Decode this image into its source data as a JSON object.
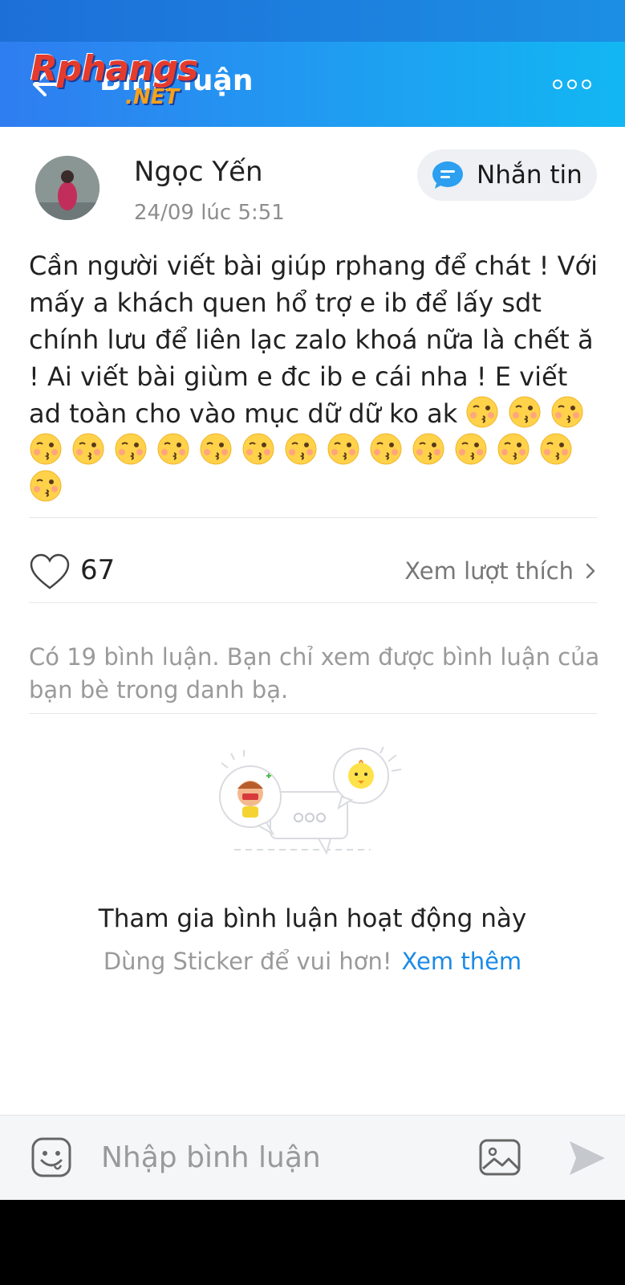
{
  "header": {
    "title": "Bình luận",
    "watermark_main": "Rphangs",
    "watermark_sub": ".NET"
  },
  "post": {
    "author": "Ngọc Yến",
    "time": "24/09 lúc 5:51",
    "message_button": "Nhắn tin",
    "text": "Cần người viết bài giúp rphang để chát ! Với mấy a khách quen hổ trợ e ib để lấy sdt chính lưu để liên lạc zalo khoá nữa là chết ă ! Ai viết bài giùm e đc ib e cái nha ! E viết ad toàn cho vào mục dữ dữ ko ak",
    "emoji_count": 17,
    "emoji_icon": "kissing-face-icon"
  },
  "likes": {
    "count": "67",
    "view_label": "Xem lượt thích"
  },
  "comments": {
    "info": "Có 19 bình luận. Bạn chỉ xem được bình luận của bạn bè trong danh bạ."
  },
  "empty_state": {
    "title": "Tham gia bình luận hoạt động này",
    "subtitle": "Dùng Sticker để vui hơn!",
    "link": "Xem thêm"
  },
  "composer": {
    "placeholder": "Nhập bình luận"
  },
  "colors": {
    "header_start": "#2f7df0",
    "header_end": "#12b7f2",
    "link": "#1b8ae6"
  }
}
